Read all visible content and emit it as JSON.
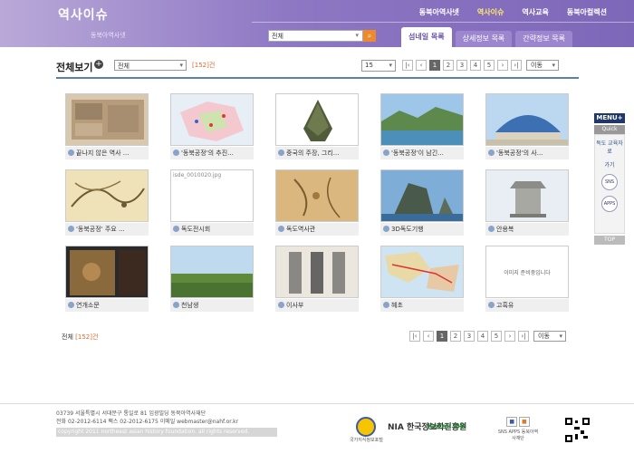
{
  "header": {
    "title": "역사이슈",
    "sub": "동북아역사넷",
    "nav": [
      "동북아역사넷",
      "역사이슈",
      "역사교육",
      "동북아컬렉션"
    ],
    "search_value": "전체",
    "tabs": [
      "섬네일 목록",
      "상세정보 목록",
      "간략정보 목록"
    ]
  },
  "toolbar": {
    "title": "전체보기",
    "filter_value": "전체",
    "count_prefix": "[",
    "count_value": "152",
    "count_suffix": "]건",
    "per_page": "15",
    "go_label": "이동"
  },
  "pagination": [
    "1",
    "2",
    "3",
    "4",
    "5"
  ],
  "items": [
    {
      "caption": "끝나지 않은 역사 ..."
    },
    {
      "caption": "'동북공정'의 추진..."
    },
    {
      "caption": "중국의 주장, 그리..."
    },
    {
      "caption": "'동북공정'이 남긴..."
    },
    {
      "caption": "'동북공정'의 사..."
    },
    {
      "caption": "'동북공정' 주요 ..."
    },
    {
      "caption": "독도전시회",
      "broken_image": "isde_0010020.jpg"
    },
    {
      "caption": "독도역사관"
    },
    {
      "caption": "3D독도기행"
    },
    {
      "caption": "안용복"
    },
    {
      "caption": "연개소문"
    },
    {
      "caption": "천남생"
    },
    {
      "caption": "이사부"
    },
    {
      "caption": "혜초"
    },
    {
      "caption": "고흑유",
      "placeholder_text": "이미지 준비중입니다"
    }
  ],
  "bottom_count": {
    "label": "전체",
    "prefix": "[",
    "value": "152",
    "suffix": "]건"
  },
  "side": {
    "menu": "MENU+",
    "quick": "Quick",
    "items": [
      "독도 교육자료",
      "가기",
      "SNS",
      "APPS"
    ],
    "top": "TOP"
  },
  "footer": {
    "addr1": "03739 서울특별시 서대문구 통일로 81 임광빌딩 동북아역사재단",
    "addr2": "전화 02-2012-6114 팩스 02-2012-6175 이메일 webmaster@nahf.or.kr",
    "copyright": "copyright 2011 northeast asian history foundation. all rights reserved.",
    "logos": [
      "국가지식정보포털",
      "NIA 한국정보화진흥원",
      "Korea DB",
      "SNS APPS 동북아역사재단"
    ]
  },
  "colors": {
    "accent_purple": "#8e78c4",
    "accent_orange": "#e0672e",
    "rule_blue": "#5b7fb4"
  }
}
